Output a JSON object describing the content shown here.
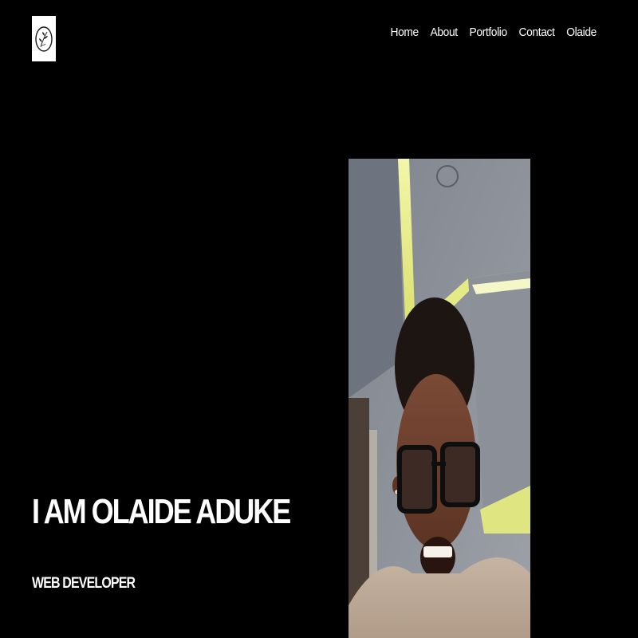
{
  "logo": {
    "icon": "leaf-monogram-icon",
    "background": "#ffffff"
  },
  "nav": {
    "items": [
      {
        "label": "Home"
      },
      {
        "label": "About"
      },
      {
        "label": "Portfolio"
      },
      {
        "label": "Contact"
      },
      {
        "label": "Olaide"
      }
    ]
  },
  "hero": {
    "title": "I AM OLAIDE ADUKE",
    "subtitle": "WEB DEVELOPER"
  },
  "portrait": {
    "description_icon": "portrait-photo-icon"
  },
  "colors": {
    "background": "#000000",
    "text": "#ffffff"
  }
}
